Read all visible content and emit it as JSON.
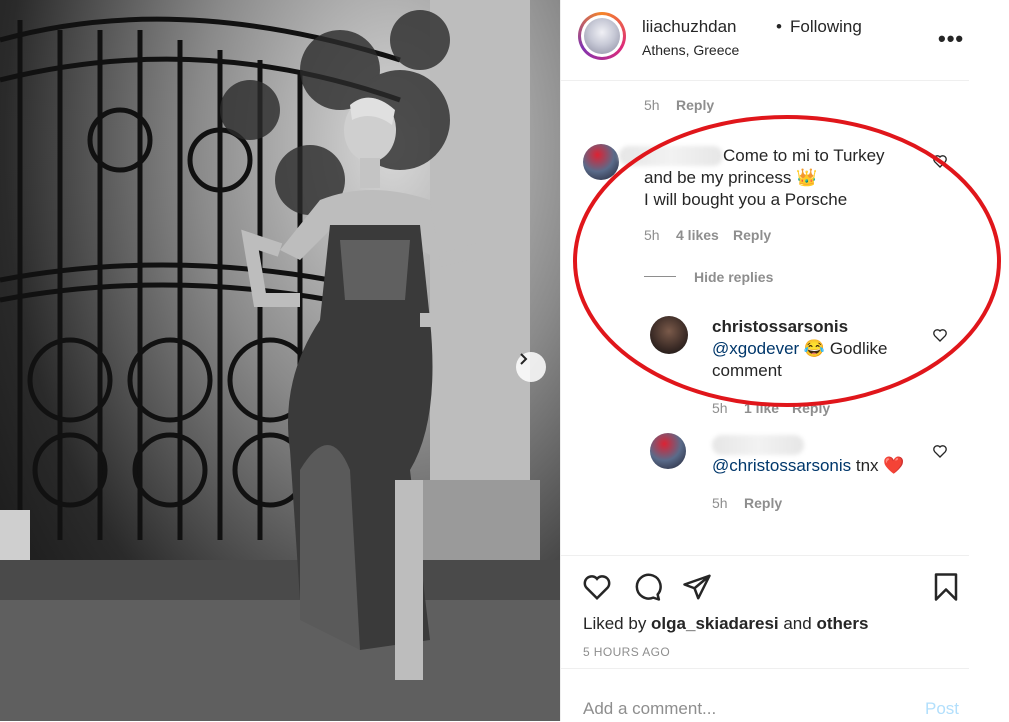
{
  "header": {
    "username": "liiachuzhdan",
    "separator": "•",
    "follow_status": "Following",
    "location": "Athens, Greece",
    "more_label": "•••"
  },
  "comments": {
    "prev": {
      "time": "5h",
      "reply": "Reply"
    },
    "main": {
      "line1": "Come to mi to Turkey",
      "line2": "and be my princess 👑",
      "line3": "I will bought you a Porsche",
      "time": "5h",
      "likes": "4 likes",
      "reply": "Reply",
      "hide_replies": "Hide replies"
    },
    "reply1": {
      "username": "christossarsonis",
      "mention": "@xgodever",
      "text_after": " 😂 Godlike",
      "text_line2": "comment",
      "time": "5h",
      "likes": "1 like",
      "reply": "Reply"
    },
    "reply2": {
      "mention": "@christossarsonis",
      "text_after": " tnx ",
      "emoji": "❤️",
      "time": "5h",
      "reply": "Reply"
    }
  },
  "footer": {
    "liked_by_prefix": "Liked by ",
    "liked_by_user": "olga_skiadaresi",
    "liked_by_mid": " and ",
    "liked_by_others": "others",
    "timestamp": "5 HOURS AGO",
    "comment_placeholder": "Add a comment...",
    "post_label": "Post"
  },
  "colors": {
    "annotation_red": "#e0161b",
    "link_blue": "#00376b",
    "post_disabled": "#b2dffc",
    "heart_red": "#ed4956"
  },
  "icons": [
    "heart-icon",
    "comment-icon",
    "share-icon",
    "bookmark-icon",
    "more-icon",
    "next-arrow-icon"
  ]
}
